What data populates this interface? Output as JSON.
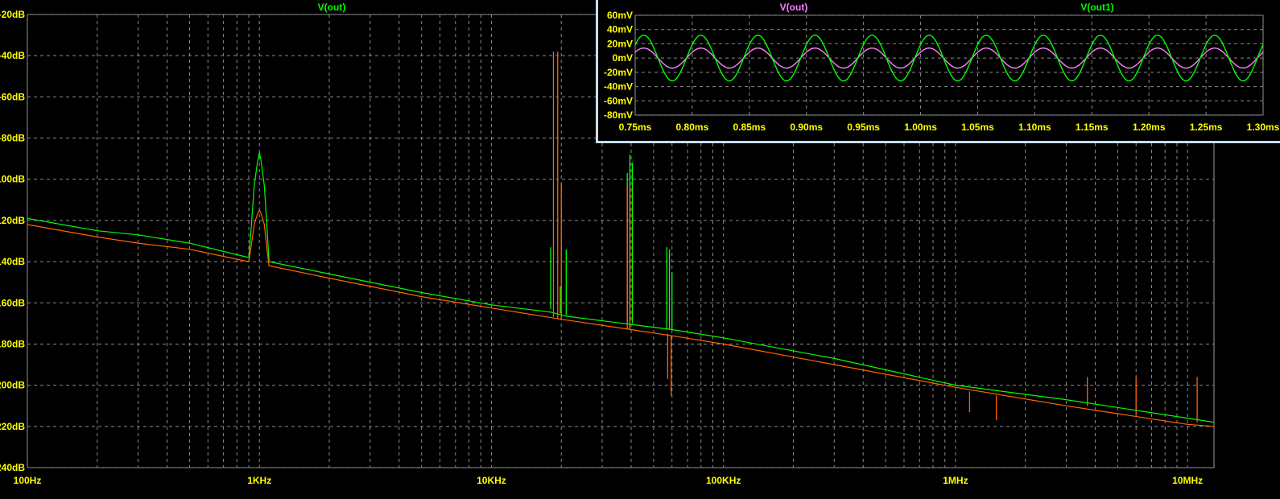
{
  "main": {
    "trace_label": "V(out)",
    "trace_color": "#00ff00",
    "chart_data": {
      "type": "line",
      "xscale": "log",
      "xlim": [
        100,
        13000000
      ],
      "ylim": [
        -240,
        -20
      ],
      "x_ticks": [
        {
          "value": 100,
          "label": "100Hz"
        },
        {
          "value": 1000,
          "label": "1KHz"
        },
        {
          "value": 10000,
          "label": "10KHz"
        },
        {
          "value": 100000,
          "label": "100KHz"
        },
        {
          "value": 1000000,
          "label": "1MHz"
        },
        {
          "value": 10000000,
          "label": "10MHz"
        }
      ],
      "y_ticks": [
        {
          "value": -20,
          "label": "-20dB"
        },
        {
          "value": -40,
          "label": "-40dB"
        },
        {
          "value": -60,
          "label": "-60dB"
        },
        {
          "value": -80,
          "label": "-80dB"
        },
        {
          "value": -100,
          "label": "100dB"
        },
        {
          "value": -120,
          "label": "120dB"
        },
        {
          "value": -140,
          "label": "140dB"
        },
        {
          "value": -160,
          "label": "160dB"
        },
        {
          "value": -180,
          "label": "180dB"
        },
        {
          "value": -200,
          "label": "200dB"
        },
        {
          "value": -220,
          "label": "220dB"
        },
        {
          "value": -240,
          "label": "240dB"
        }
      ],
      "grid": true,
      "series": [
        {
          "color": "#00ff00",
          "x": [
            100,
            200,
            300,
            500,
            900,
            920,
            950,
            980,
            1000,
            1020,
            1050,
            1080,
            1100,
            2000,
            5000,
            10000,
            18000,
            19500,
            21000,
            40000,
            60000,
            100000,
            300000,
            1000000,
            3000000,
            10000000,
            13000000
          ],
          "y": [
            -119,
            -125,
            -127,
            -131,
            -138,
            -125,
            -103,
            -92,
            -87,
            -92,
            -103,
            -125,
            -140,
            -146,
            -155,
            -161,
            -164.5,
            -165.5,
            -166.5,
            -170.5,
            -173,
            -177,
            -187,
            -200,
            -207,
            -216,
            -218
          ],
          "spikes": [
            {
              "x": 18000,
              "from": -163,
              "to": -133
            },
            {
              "x": 19800,
              "from": -165,
              "to": -152
            },
            {
              "x": 21000,
              "from": -166,
              "to": -134
            },
            {
              "x": 38500,
              "from": -170,
              "to": -97
            },
            {
              "x": 39500,
              "from": -170,
              "to": -88
            },
            {
              "x": 40500,
              "from": -170,
              "to": -92
            },
            {
              "x": 57000,
              "from": -173,
              "to": -133
            },
            {
              "x": 58500,
              "from": -173,
              "to": -134
            },
            {
              "x": 60000,
              "from": -173,
              "to": -145
            }
          ]
        },
        {
          "color": "#ff6600",
          "x": [
            100,
            200,
            300,
            500,
            900,
            920,
            950,
            980,
            1000,
            1020,
            1050,
            1080,
            1100,
            2000,
            5000,
            10000,
            20000,
            40000,
            60000,
            100000,
            300000,
            1000000,
            3000000,
            10000000,
            13000000
          ],
          "y": [
            -122,
            -128,
            -131,
            -134,
            -140,
            -133,
            -122,
            -117,
            -115,
            -117,
            -122,
            -135,
            -142,
            -148,
            -157,
            -162.5,
            -168,
            -173,
            -176,
            -180,
            -190,
            -201,
            -210,
            -219,
            -220
          ],
          "spikes": [
            {
              "x": 18500,
              "from": -167,
              "to": -38
            },
            {
              "x": 19300,
              "from": -168,
              "to": -38
            },
            {
              "x": 20000,
              "from": -168,
              "to": -102
            },
            {
              "x": 38500,
              "from": -173,
              "to": -103
            },
            {
              "x": 39500,
              "from": -173,
              "to": -103
            },
            {
              "x": 57500,
              "from": -175,
              "to": -197
            },
            {
              "x": 59500,
              "from": -176,
              "to": -205
            },
            {
              "x": 1150000,
              "from": -203,
              "to": -213
            },
            {
              "x": 1500000,
              "from": -205,
              "to": -217
            },
            {
              "x": 3700000,
              "from": -210,
              "to": -196
            },
            {
              "x": 6000000,
              "from": -214,
              "to": -196
            },
            {
              "x": 11000000,
              "from": -218,
              "to": -196
            }
          ]
        }
      ]
    }
  },
  "inset": {
    "labels": [
      {
        "text": "V(out)",
        "color": "#ff80ff"
      },
      {
        "text": "V(out1)",
        "color": "#00ff00"
      }
    ],
    "chart_data": {
      "type": "line",
      "xlim": [
        0.75,
        1.3
      ],
      "ylim": [
        -80,
        60
      ],
      "x_ticks": [
        {
          "value": 0.75,
          "label": "0.75ms"
        },
        {
          "value": 0.8,
          "label": "0.80ms"
        },
        {
          "value": 0.85,
          "label": "0.85ms"
        },
        {
          "value": 0.9,
          "label": "0.90ms"
        },
        {
          "value": 0.95,
          "label": "0.95ms"
        },
        {
          "value": 1.0,
          "label": "1.00ms"
        },
        {
          "value": 1.05,
          "label": "1.05ms"
        },
        {
          "value": 1.1,
          "label": "1.10ms"
        },
        {
          "value": 1.15,
          "label": "1.15ms"
        },
        {
          "value": 1.2,
          "label": "1.20ms"
        },
        {
          "value": 1.25,
          "label": "1.25ms"
        },
        {
          "value": 1.3,
          "label": "1.30ms"
        }
      ],
      "y_ticks": [
        {
          "value": 60,
          "label": "60mV"
        },
        {
          "value": 40,
          "label": "40mV"
        },
        {
          "value": 20,
          "label": "20mV"
        },
        {
          "value": 0,
          "label": "0mV"
        },
        {
          "value": -20,
          "label": "-20mV"
        },
        {
          "value": -40,
          "label": "-40mV"
        },
        {
          "value": -60,
          "label": "-60mV"
        },
        {
          "value": -80,
          "label": "-80mV"
        }
      ],
      "grid": true,
      "series": [
        {
          "name": "V(out)",
          "color": "#ff80ff",
          "amplitude_mV": 14,
          "frequency_kHz": 20,
          "peak_time_ms": 0.8075
        },
        {
          "name": "V(out1)",
          "color": "#00ff00",
          "amplitude_mV": 32,
          "frequency_kHz": 20,
          "peak_time_ms": 0.8075
        }
      ]
    }
  }
}
